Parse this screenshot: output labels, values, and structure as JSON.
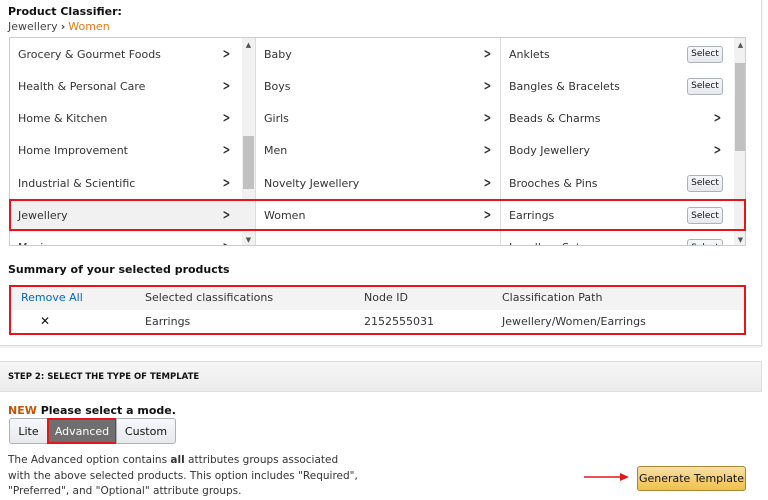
{
  "classifier": {
    "title": "Product Classifier:",
    "breadcrumb": [
      "Jewellery",
      "Women"
    ],
    "columns": [
      {
        "items": [
          "Grocery & Gourmet Foods",
          "Health & Personal Care",
          "Home & Kitchen",
          "Home Improvement",
          "Industrial & Scientific",
          "Jewellery",
          "Music"
        ],
        "selected": "Jewellery"
      },
      {
        "items": [
          "Baby",
          "Boys",
          "Girls",
          "Men",
          "Novelty Jewellery",
          "Women"
        ],
        "selected": "Women"
      },
      {
        "items": [
          {
            "label": "Anklets",
            "action": "Select"
          },
          {
            "label": "Bangles & Bracelets",
            "action": "Select"
          },
          {
            "label": "Beads & Charms",
            "action": "chevron"
          },
          {
            "label": "Body Jewellery",
            "action": "chevron"
          },
          {
            "label": "Brooches & Pins",
            "action": "Select"
          },
          {
            "label": "Earrings",
            "action": "Select"
          },
          {
            "label": "Jewellery Sets",
            "action": "Select"
          }
        ],
        "selected": "Earrings"
      }
    ]
  },
  "summary": {
    "title": "Summary of your selected products",
    "remove_all": "Remove All",
    "headers": [
      "Selected classifications",
      "Node ID",
      "Classification Path"
    ],
    "rows": [
      {
        "remove": "✕",
        "classification": "Earrings",
        "node_id": "2152555031",
        "path": "Jewellery/Women/Earrings"
      }
    ]
  },
  "step2": {
    "header": "STEP 2: SELECT THE TYPE OF TEMPLATE",
    "new_badge": "NEW",
    "prompt": "Please select a mode.",
    "modes": [
      "Lite",
      "Advanced",
      "Custom"
    ],
    "selected_mode": "Advanced",
    "desc_pre": "The Advanced option contains ",
    "desc_bold": "all",
    "desc_post": " attributes groups associated with the above selected products. This option includes \"Required\", \"Preferred\", and \"Optional\" attribute groups.",
    "generate": "Generate Template"
  },
  "colors": {
    "accent": "#e47911",
    "highlight": "#e3161c",
    "link": "#0066c0",
    "button": "#f0c14b"
  }
}
